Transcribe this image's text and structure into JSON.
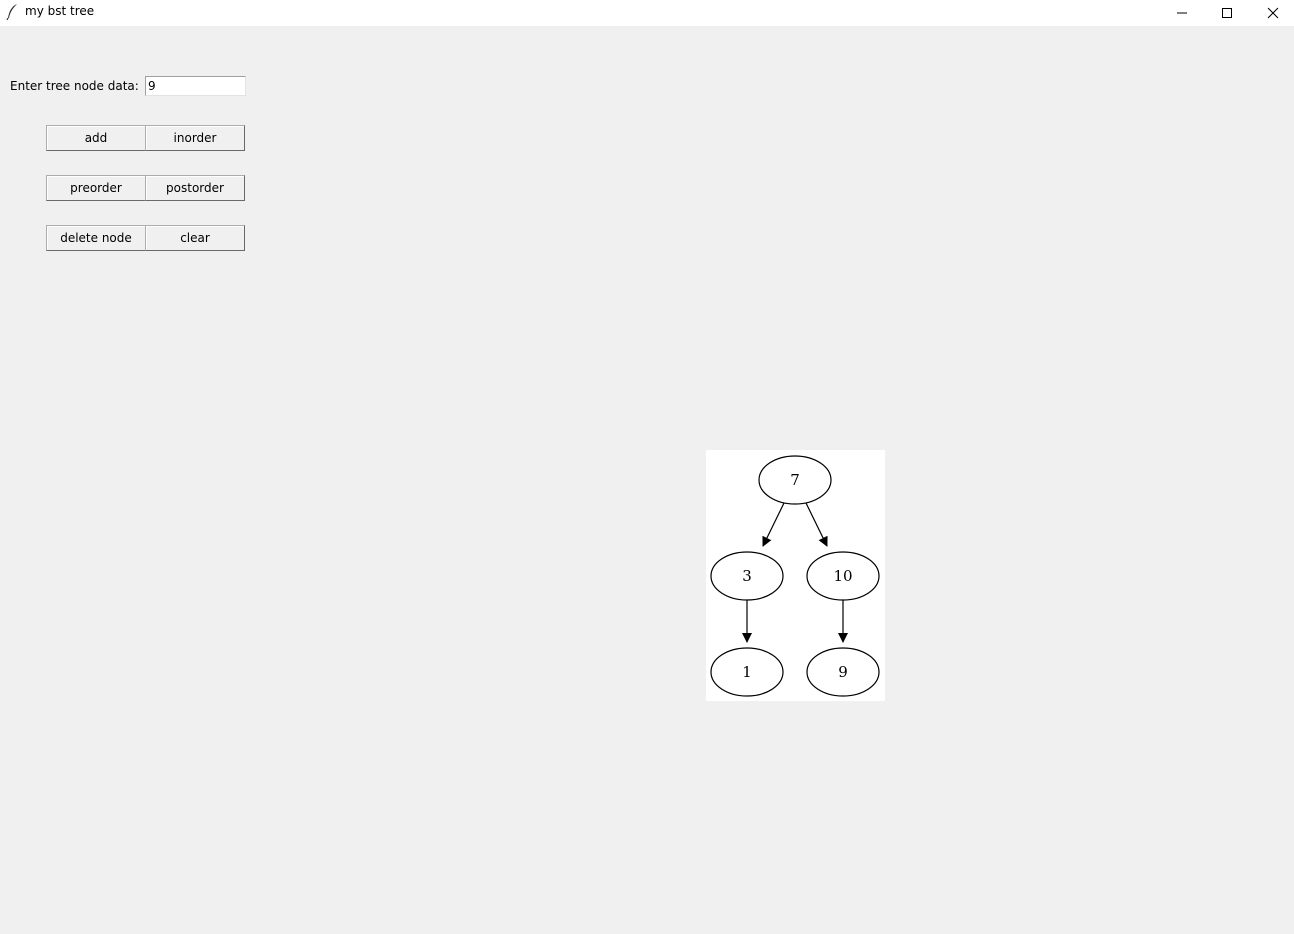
{
  "window": {
    "title": "my bst tree",
    "icons": {
      "app": "feather-icon",
      "minimize": "minimize-icon",
      "maximize": "maximize-icon",
      "close": "close-icon"
    }
  },
  "form": {
    "label": "Enter tree node data:",
    "input_value": "9"
  },
  "buttons": {
    "add": "add",
    "inorder": "inorder",
    "preorder": "preorder",
    "postorder": "postorder",
    "delete": "delete node",
    "clear": "clear"
  },
  "tree": {
    "nodes": [
      {
        "id": "n7",
        "label": "7"
      },
      {
        "id": "n3",
        "label": "3"
      },
      {
        "id": "n10",
        "label": "10"
      },
      {
        "id": "n1",
        "label": "1"
      },
      {
        "id": "n9",
        "label": "9"
      }
    ],
    "edges": [
      {
        "from": "7",
        "to": "3"
      },
      {
        "from": "7",
        "to": "10"
      },
      {
        "from": "3",
        "to": "1"
      },
      {
        "from": "10",
        "to": "9"
      }
    ]
  }
}
